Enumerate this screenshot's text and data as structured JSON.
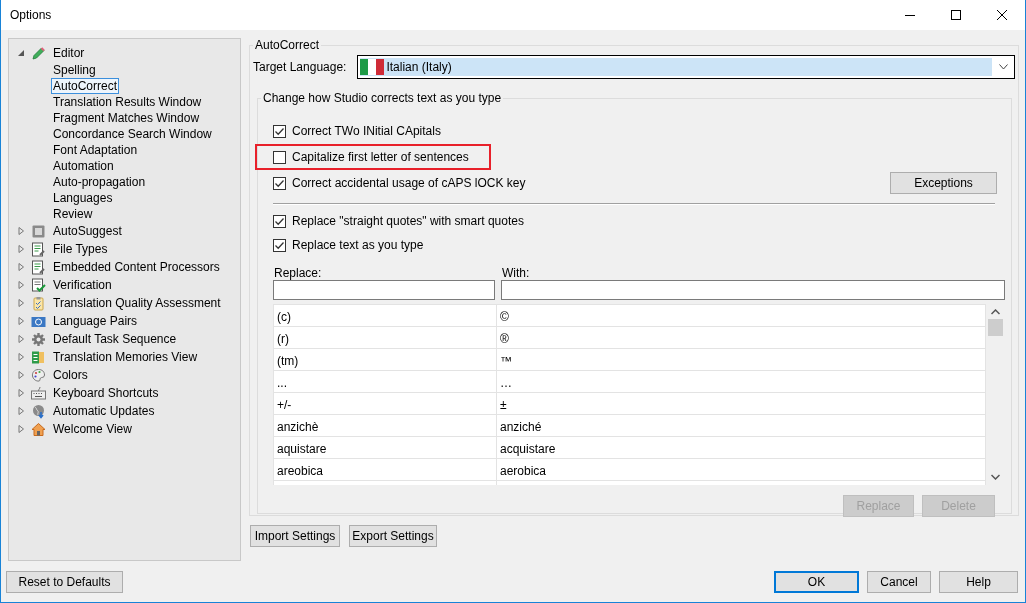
{
  "window": {
    "title": "Options"
  },
  "tree": [
    {
      "label": "Editor",
      "expanded": true,
      "selected": false,
      "children": [
        {
          "label": "Spelling",
          "selected": false
        },
        {
          "label": "AutoCorrect",
          "selected": true
        },
        {
          "label": "Translation Results Window",
          "selected": false
        },
        {
          "label": "Fragment Matches Window",
          "selected": false
        },
        {
          "label": "Concordance Search Window",
          "selected": false
        },
        {
          "label": "Font Adaptation",
          "selected": false
        },
        {
          "label": "Automation",
          "selected": false
        },
        {
          "label": "Auto-propagation",
          "selected": false
        },
        {
          "label": "Languages",
          "selected": false
        },
        {
          "label": "Review",
          "selected": false
        }
      ]
    },
    {
      "label": "AutoSuggest",
      "expanded": false,
      "selected": false
    },
    {
      "label": "File Types",
      "expanded": false,
      "selected": false
    },
    {
      "label": "Embedded Content Processors",
      "expanded": false,
      "selected": false
    },
    {
      "label": "Verification",
      "expanded": false,
      "selected": false
    },
    {
      "label": "Translation Quality Assessment",
      "expanded": false,
      "selected": false
    },
    {
      "label": "Language Pairs",
      "expanded": false,
      "selected": false
    },
    {
      "label": "Default Task Sequence",
      "expanded": false,
      "selected": false
    },
    {
      "label": "Translation Memories View",
      "expanded": false,
      "selected": false
    },
    {
      "label": "Colors",
      "expanded": false,
      "selected": false
    },
    {
      "label": "Keyboard Shortcuts",
      "expanded": false,
      "selected": false
    },
    {
      "label": "Automatic Updates",
      "expanded": false,
      "selected": false
    },
    {
      "label": "Welcome View",
      "expanded": false,
      "selected": false
    }
  ],
  "autocorrect": {
    "title": "AutoCorrect",
    "target_language": {
      "label": "Target Language:",
      "value": "Italian (Italy)"
    },
    "group": {
      "title": "Change how Studio corrects text as you type",
      "options": [
        {
          "label": "Correct TWo INitial CApitals",
          "checked": true,
          "highlighted": false
        },
        {
          "label": "Capitalize first letter of sentences",
          "checked": false,
          "highlighted": true
        },
        {
          "label": "Correct accidental usage of cAPS lOCK key",
          "checked": true,
          "highlighted": false
        }
      ],
      "exceptions_button": "Exceptions",
      "replace_options": [
        {
          "label": "Replace \"straight quotes\" with smart quotes",
          "checked": true
        },
        {
          "label": "Replace text as you type",
          "checked": true
        }
      ],
      "replace_label": "Replace:",
      "with_label": "With:",
      "rows": [
        [
          "(c)",
          "©"
        ],
        [
          "(r)",
          "®"
        ],
        [
          "(tm)",
          "™"
        ],
        [
          "...",
          "…"
        ],
        [
          "+/-",
          "±"
        ],
        [
          "anzichè",
          "anziché"
        ],
        [
          "aquistare",
          "acquistare"
        ],
        [
          "areobica",
          "aerobica"
        ]
      ],
      "buttons": [
        {
          "label": "Replace",
          "disabled": true
        },
        {
          "label": "Delete",
          "disabled": true
        }
      ]
    }
  },
  "settings_buttons": [
    "Import Settings",
    "Export Settings"
  ],
  "footer": {
    "reset_button": "Reset to Defaults",
    "buttons": [
      "OK",
      "Cancel",
      "Help"
    ]
  }
}
